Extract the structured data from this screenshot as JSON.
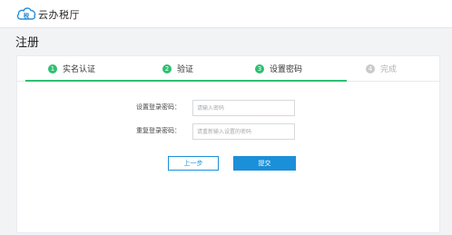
{
  "header": {
    "brand": "云办税厅",
    "logo_text": "税"
  },
  "page": {
    "title": "注册"
  },
  "steps": [
    {
      "num": "1",
      "label": "实名认证",
      "state": "done"
    },
    {
      "num": "2",
      "label": "验证",
      "state": "done"
    },
    {
      "num": "3",
      "label": "设置密码",
      "state": "done"
    },
    {
      "num": "4",
      "label": "完成",
      "state": "todo"
    }
  ],
  "form": {
    "password_label": "设置登录密码：",
    "password_placeholder": "请输入密码",
    "password_value": "",
    "confirm_label": "重复登录密码：",
    "confirm_placeholder": "请重新输入设置的密码",
    "confirm_value": ""
  },
  "buttons": {
    "prev_label": "上一步",
    "submit_label": "提交"
  },
  "colors": {
    "accent": "#1b8fd8",
    "success": "#2fbf71",
    "pending": "#c9c9c9"
  }
}
